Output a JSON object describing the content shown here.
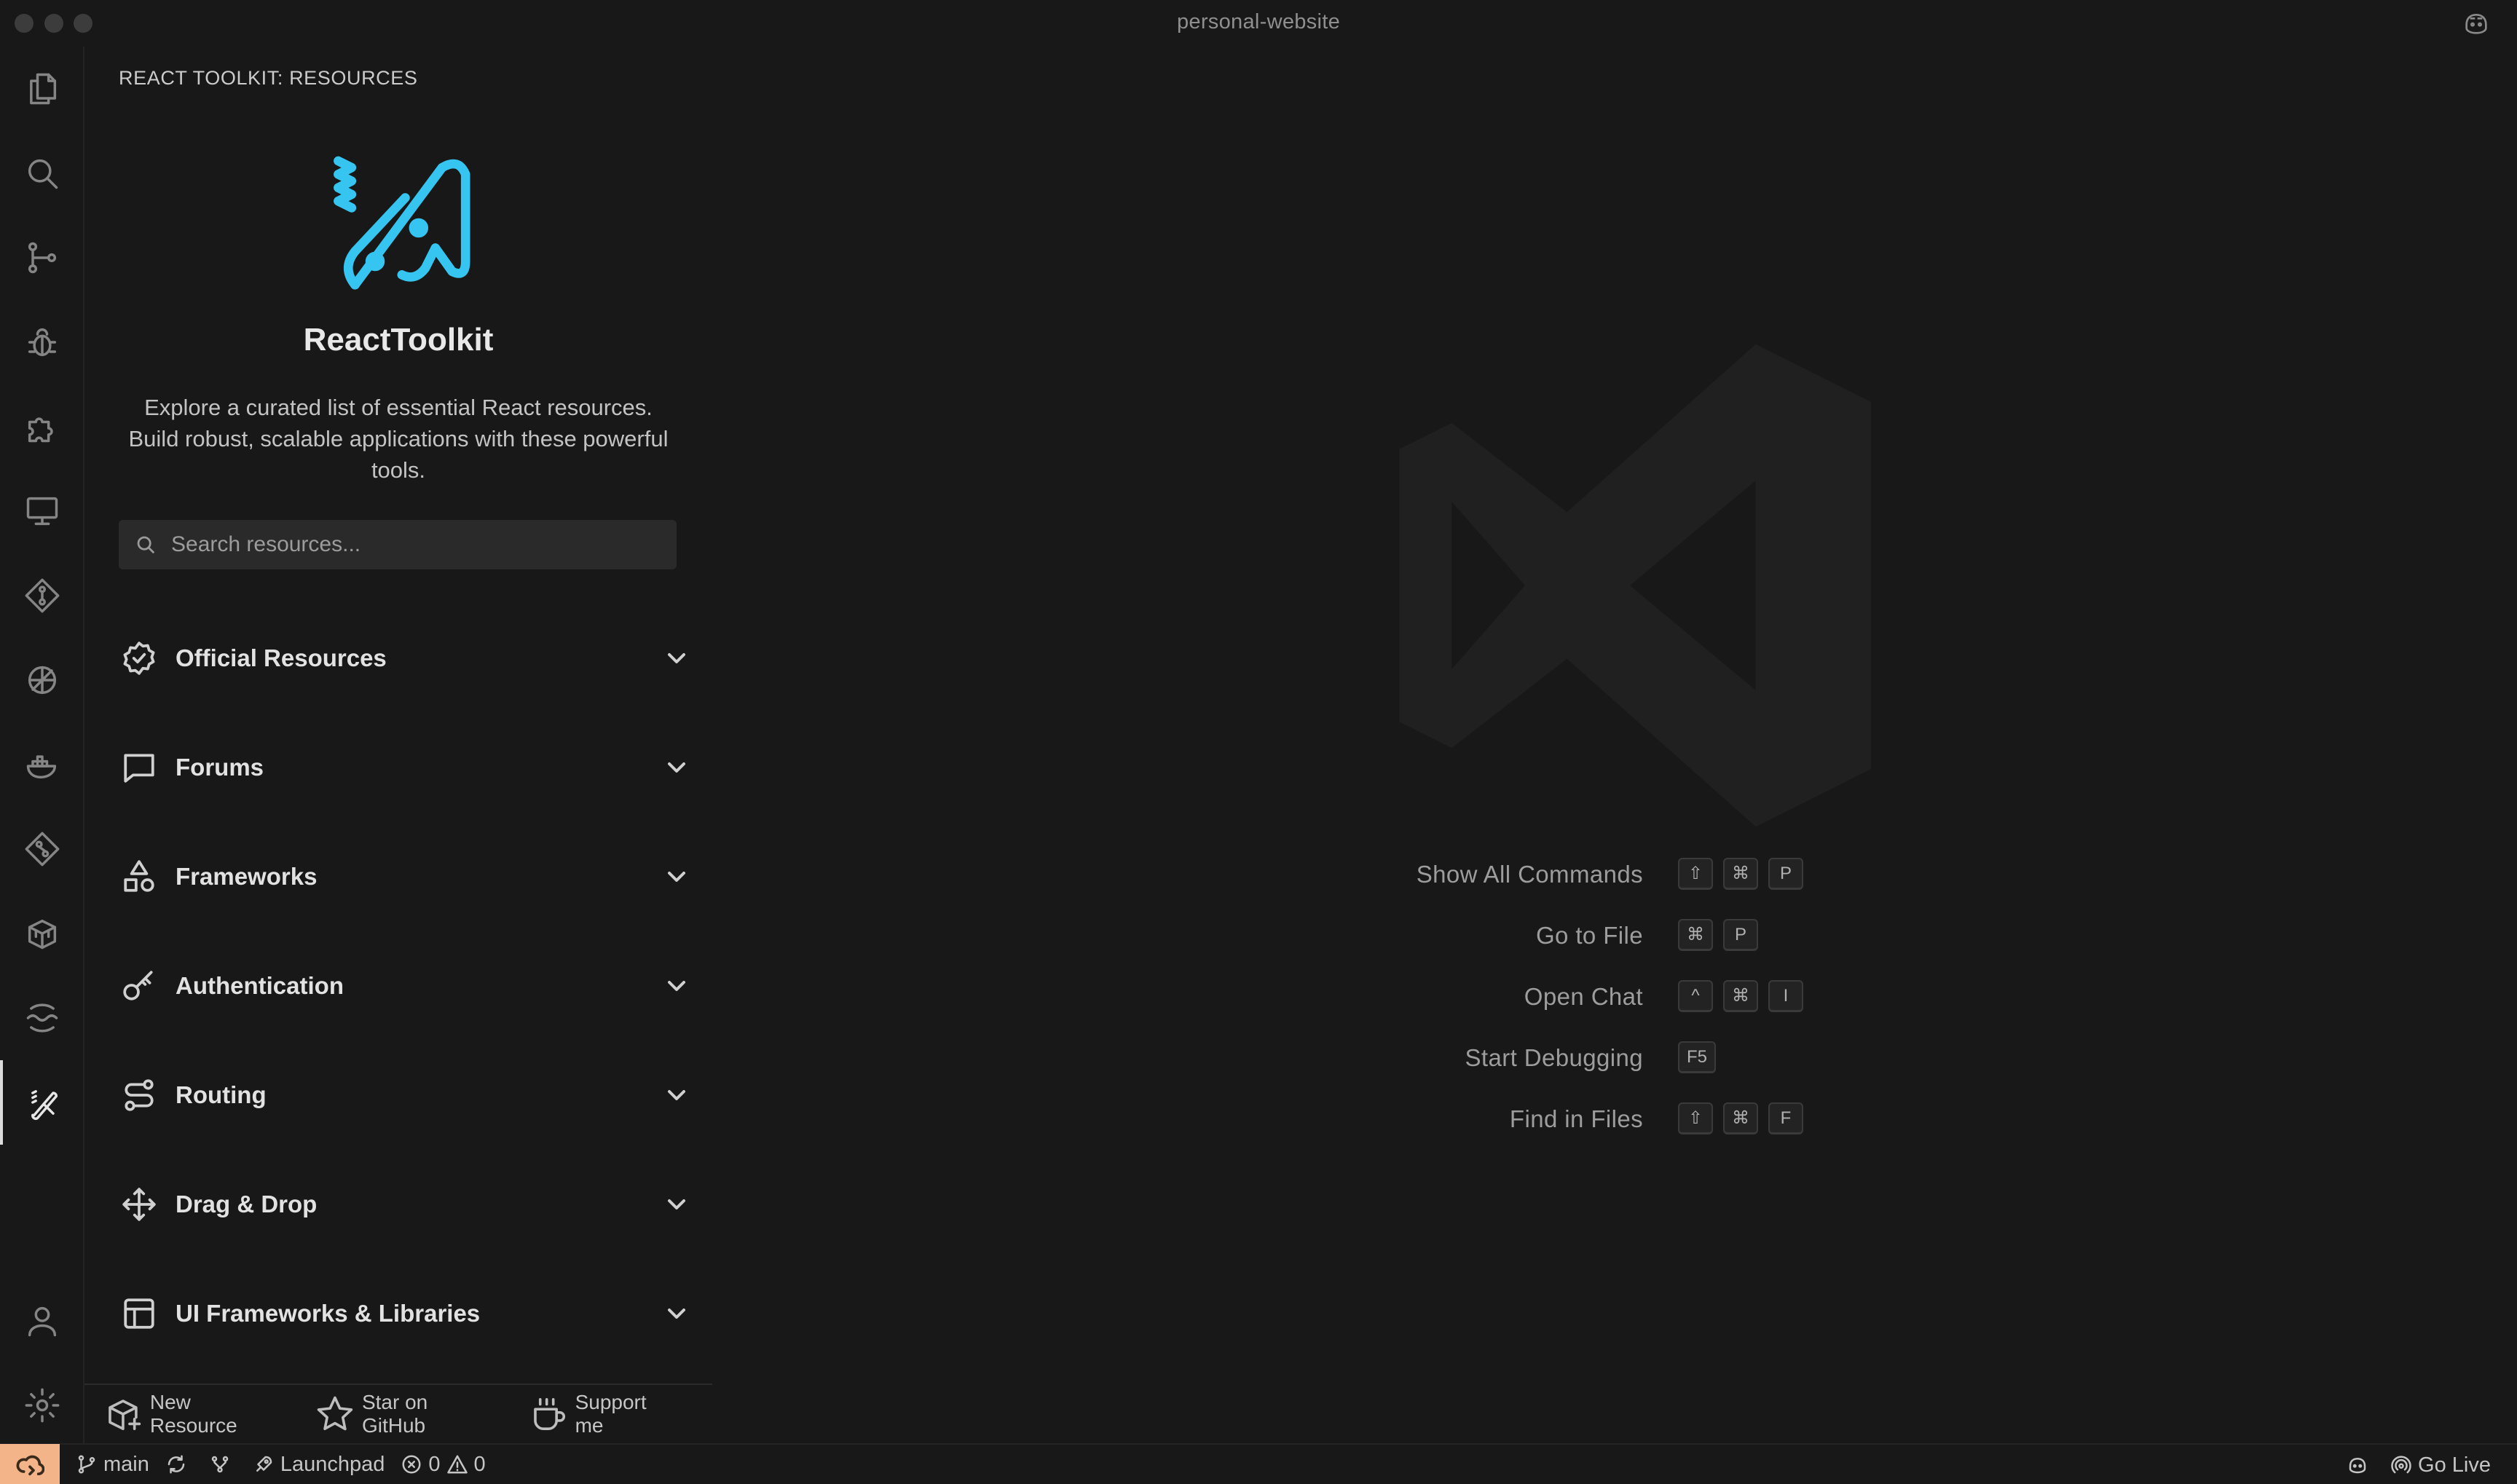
{
  "window": {
    "title": "personal-website"
  },
  "activity_bar": {
    "items": [
      {
        "name": "explorer-icon"
      },
      {
        "name": "search-icon"
      },
      {
        "name": "source-control-icon"
      },
      {
        "name": "run-debug-icon"
      },
      {
        "name": "extensions-icon"
      },
      {
        "name": "remote-explorer-icon"
      },
      {
        "name": "git-graph-icon"
      },
      {
        "name": "database-icon"
      },
      {
        "name": "docker-icon"
      },
      {
        "name": "gitlens-icon"
      },
      {
        "name": "packages-icon"
      },
      {
        "name": "waves-icon"
      },
      {
        "name": "react-toolkit-icon",
        "active": true
      }
    ],
    "bottom": [
      {
        "name": "accounts-icon"
      },
      {
        "name": "manage-gear-icon"
      }
    ]
  },
  "sidebar": {
    "title": "REACT TOOLKIT: RESOURCES",
    "app_name": "ReactToolkit",
    "description": "Explore a curated list of essential React resources. Build robust, scalable applications with these powerful tools.",
    "search_placeholder": "Search resources...",
    "sections": [
      {
        "label": "Official Resources",
        "icon": "badge-check-icon"
      },
      {
        "label": "Forums",
        "icon": "message-square-icon"
      },
      {
        "label": "Frameworks",
        "icon": "shapes-icon"
      },
      {
        "label": "Authentication",
        "icon": "key-icon"
      },
      {
        "label": "Routing",
        "icon": "route-icon"
      },
      {
        "label": "Drag & Drop",
        "icon": "move-icon"
      },
      {
        "label": "UI Frameworks & Libraries",
        "icon": "layout-icon"
      }
    ],
    "footer": {
      "new_resource": "New Resource",
      "star_github": "Star on GitHub",
      "support": "Support me"
    },
    "accent_color": "#36c5f0"
  },
  "editor": {
    "shortcuts": [
      {
        "label": "Show All Commands",
        "keys": [
          "⇧",
          "⌘",
          "P"
        ]
      },
      {
        "label": "Go to File",
        "keys": [
          "⌘",
          "P"
        ]
      },
      {
        "label": "Open Chat",
        "keys": [
          "^",
          "⌘",
          "I"
        ]
      },
      {
        "label": "Start Debugging",
        "keys": [
          "F5"
        ]
      },
      {
        "label": "Find in Files",
        "keys": [
          "⇧",
          "⌘",
          "F"
        ]
      }
    ]
  },
  "status_bar": {
    "branch": "main",
    "launchpad": "Launchpad",
    "errors": "0",
    "warnings": "0",
    "go_live": "Go Live",
    "remote_color": "#f2b488"
  }
}
